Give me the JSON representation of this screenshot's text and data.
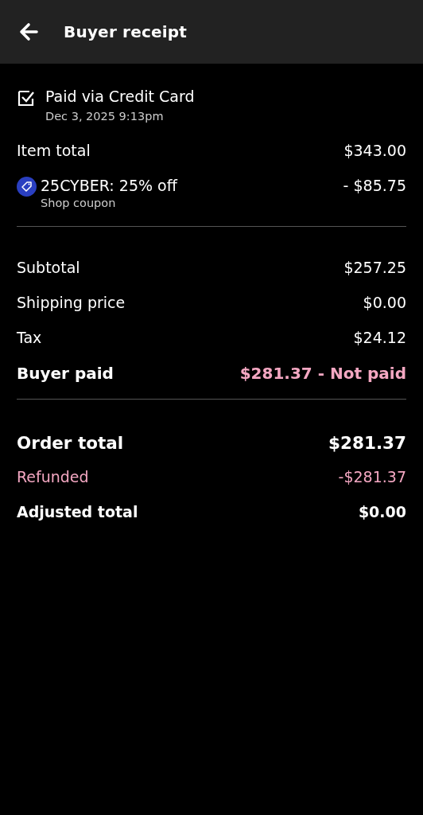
{
  "header": {
    "title": "Buyer receipt"
  },
  "payment": {
    "label": "Paid via Credit Card",
    "date": "Dec 3, 2025 9:13pm",
    "checked": true
  },
  "sections": [
    {
      "rows": [
        {
          "kind": "line",
          "label": "Item total",
          "value": "$343.00"
        },
        {
          "kind": "coupon",
          "label": "25CYBER: 25% off",
          "sublabel": "Shop coupon",
          "value": "- $85.75"
        }
      ]
    },
    {
      "rows": [
        {
          "kind": "line",
          "label": "Subtotal",
          "value": "$257.25"
        },
        {
          "kind": "line",
          "label": "Shipping price",
          "value": "$0.00"
        },
        {
          "kind": "line",
          "label": "Tax",
          "value": "$24.12"
        },
        {
          "kind": "alert",
          "label": "Buyer paid",
          "value": "$281.37 - Not paid"
        }
      ]
    },
    {
      "rows": [
        {
          "kind": "total",
          "label": "Order total",
          "value": "$281.37"
        },
        {
          "kind": "refund",
          "label": "Refunded",
          "value": "-$281.37"
        },
        {
          "kind": "strong",
          "label": "Adjusted total",
          "value": "$0.00"
        }
      ]
    }
  ]
}
